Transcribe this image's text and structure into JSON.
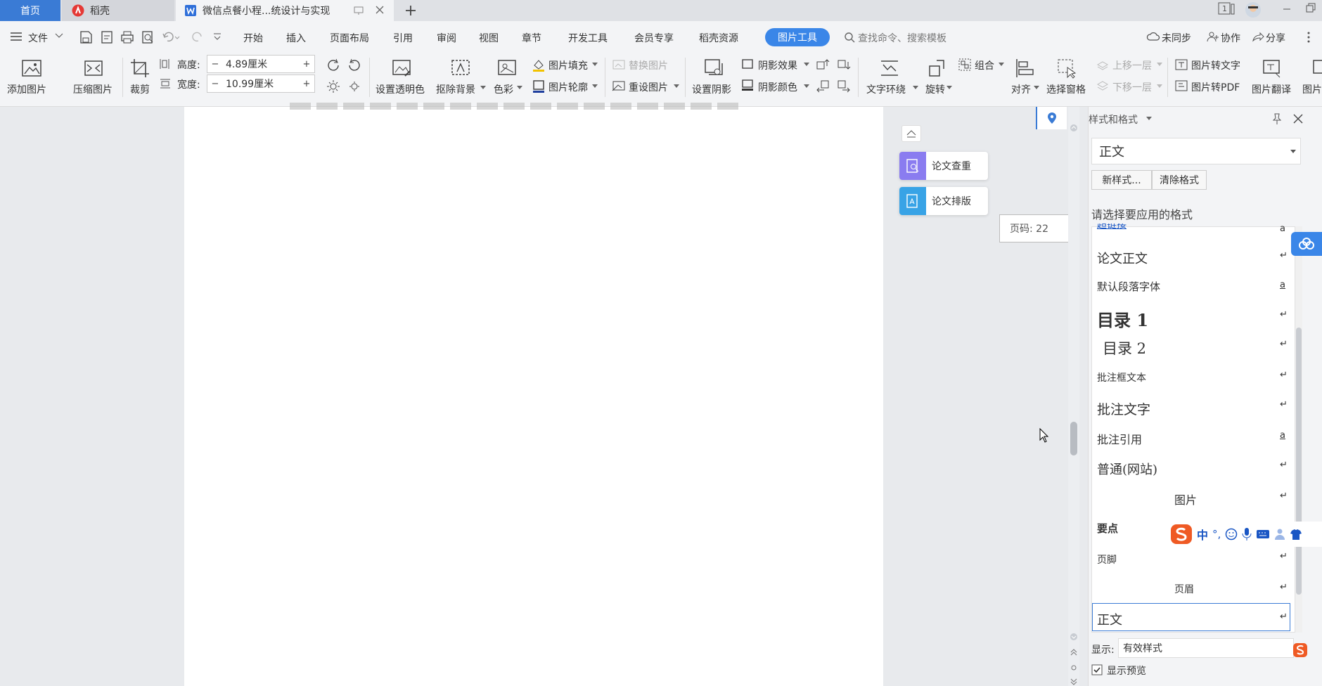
{
  "tabs": {
    "home": "首页",
    "daoke": "稻壳",
    "doc": "微信点餐小程...统设计与实现"
  },
  "menu": {
    "file": "文件",
    "items": [
      "开始",
      "插入",
      "页面布局",
      "引用",
      "审阅",
      "视图",
      "章节",
      "开发工具",
      "会员专享",
      "稻壳资源"
    ],
    "active_tool": "图片工具",
    "search_placeholder": "查找命令、搜索模板",
    "sync": "未同步",
    "collab": "协作",
    "share": "分享"
  },
  "ribbon": {
    "add_image": "添加图片",
    "compress": "压缩图片",
    "crop": "裁剪",
    "height_label": "高度:",
    "height_value": "4.89厘米",
    "width_label": "宽度:",
    "width_value": "10.99厘米",
    "set_transparent": "设置透明色",
    "remove_bg": "抠除背景",
    "color": "色彩",
    "image_fill": "图片填充",
    "image_outline": "图片轮廓",
    "replace_image": "替换图片",
    "reset_image": "重设图片",
    "set_shadow": "设置阴影",
    "shadow_effect": "阴影效果",
    "shadow_color": "阴影颜色",
    "text_wrap": "文字环绕",
    "rotate": "旋转",
    "group": "组合",
    "align": "对齐",
    "selection_pane": "选择窗格",
    "bring_forward": "上移一层",
    "send_backward": "下移一层",
    "img_to_text": "图片转文字",
    "img_to_pdf": "图片转PDF",
    "img_translate": "图片翻译",
    "img_more": "图片"
  },
  "side_buttons": {
    "check": "论文查重",
    "layout": "论文排版"
  },
  "page_number": "页码: 22",
  "style_panel": {
    "title": "样式和格式",
    "current_style": "正文",
    "new_style": "新样式...",
    "clear_format": "清除格式",
    "prompt": "请选择要应用的格式",
    "items": [
      "超链接",
      "论文正文",
      "默认段落字体",
      "目录 1",
      "目录 2",
      "批注框文本",
      "批注文字",
      "批注引用",
      "普通(网站)",
      "图片",
      "要点",
      "页脚",
      "页眉",
      "正文"
    ],
    "show_label": "显示:",
    "show_value": "有效样式",
    "preview_label": "显示预览"
  },
  "ime": {
    "zh": "中"
  },
  "colors": {
    "accent": "#3a7bd5",
    "active_tool_bg": "#3a86e8",
    "ime_orange": "#ef5a24"
  }
}
